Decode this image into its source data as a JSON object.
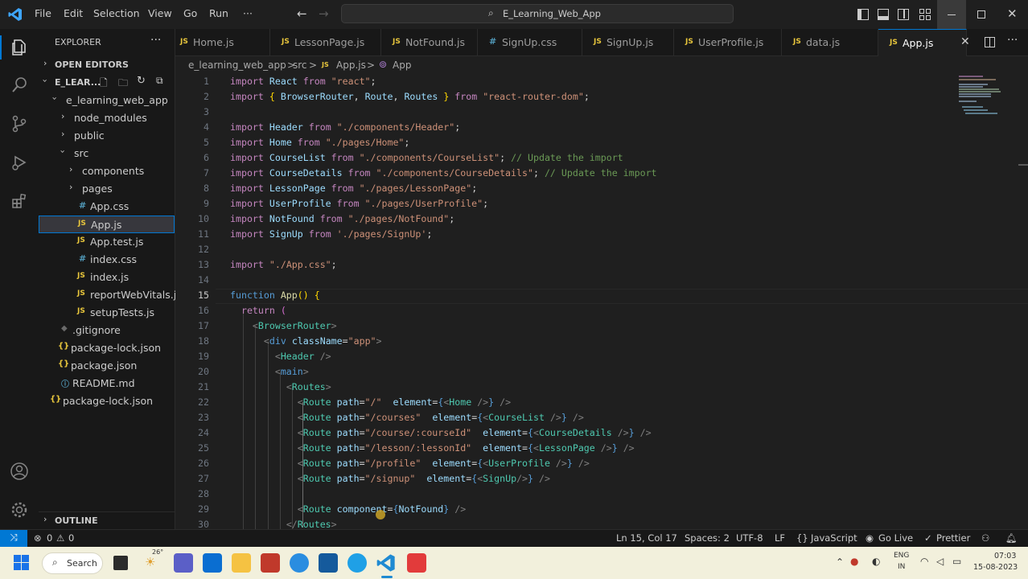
{
  "titlebar": {
    "menu": [
      "File",
      "Edit",
      "Selection",
      "View",
      "Go",
      "Run",
      "···"
    ],
    "search_text": "E_Learning_Web_App"
  },
  "sidebar": {
    "header": "EXPLORER",
    "open_editors": "OPEN EDITORS",
    "workspace": "E_LEAR...",
    "tree": [
      {
        "label": "e_learning_web_app",
        "type": "folder-open"
      },
      {
        "label": "node_modules",
        "type": "folder"
      },
      {
        "label": "public",
        "type": "folder"
      },
      {
        "label": "src",
        "type": "folder-open"
      },
      {
        "label": "components",
        "type": "folder"
      },
      {
        "label": "pages",
        "type": "folder"
      },
      {
        "label": "App.css",
        "type": "css"
      },
      {
        "label": "App.js",
        "type": "js"
      },
      {
        "label": "App.test.js",
        "type": "js"
      },
      {
        "label": "index.css",
        "type": "css"
      },
      {
        "label": "index.js",
        "type": "js"
      },
      {
        "label": "reportWebVitals.js",
        "type": "js"
      },
      {
        "label": "setupTests.js",
        "type": "js"
      },
      {
        "label": ".gitignore",
        "type": "git"
      },
      {
        "label": "package-lock.json",
        "type": "json"
      },
      {
        "label": "package.json",
        "type": "json"
      },
      {
        "label": "README.md",
        "type": "md"
      },
      {
        "label": "package-lock.json",
        "type": "json"
      }
    ],
    "outline": "OUTLINE"
  },
  "tabs": [
    {
      "label": "Home.js",
      "icon": "JS"
    },
    {
      "label": "LessonPage.js",
      "icon": "JS"
    },
    {
      "label": "NotFound.js",
      "icon": "JS"
    },
    {
      "label": "SignUp.css",
      "icon": "#"
    },
    {
      "label": "SignUp.js",
      "icon": "JS"
    },
    {
      "label": "UserProfile.js",
      "icon": "JS"
    },
    {
      "label": "data.js",
      "icon": "JS"
    },
    {
      "label": "App.js",
      "icon": "JS"
    }
  ],
  "breadcrumb": {
    "parts": [
      "e_learning_web_app",
      ">",
      "src",
      ">",
      "JS",
      "App.js",
      ">",
      "App"
    ]
  },
  "code": {
    "line_numbers": [
      "1",
      "2",
      "3",
      "4",
      "5",
      "6",
      "7",
      "8",
      "9",
      "10",
      "11",
      "12",
      "13",
      "14",
      "15",
      "16",
      "17",
      "18",
      "19",
      "20",
      "21",
      "22",
      "23",
      "24",
      "25",
      "26",
      "27",
      "28",
      "29",
      "30"
    ],
    "current_line": "15"
  },
  "statusbar": {
    "problems": "0",
    "warnings": "0",
    "position": "Ln 15, Col 17",
    "spaces": "Spaces: 2",
    "encoding": "UTF-8",
    "eol": "LF",
    "language": "JavaScript",
    "golive": "Go Live",
    "prettier": "Prettier"
  },
  "taskbar": {
    "search": "Search",
    "weather": "26°",
    "lang1": "ENG",
    "lang2": "IN",
    "time": "07:03",
    "date": "15-08-2023"
  },
  "colors": {
    "accent": "#0078d4",
    "js_icon": "#e8c63c",
    "css_icon": "#519aba"
  }
}
